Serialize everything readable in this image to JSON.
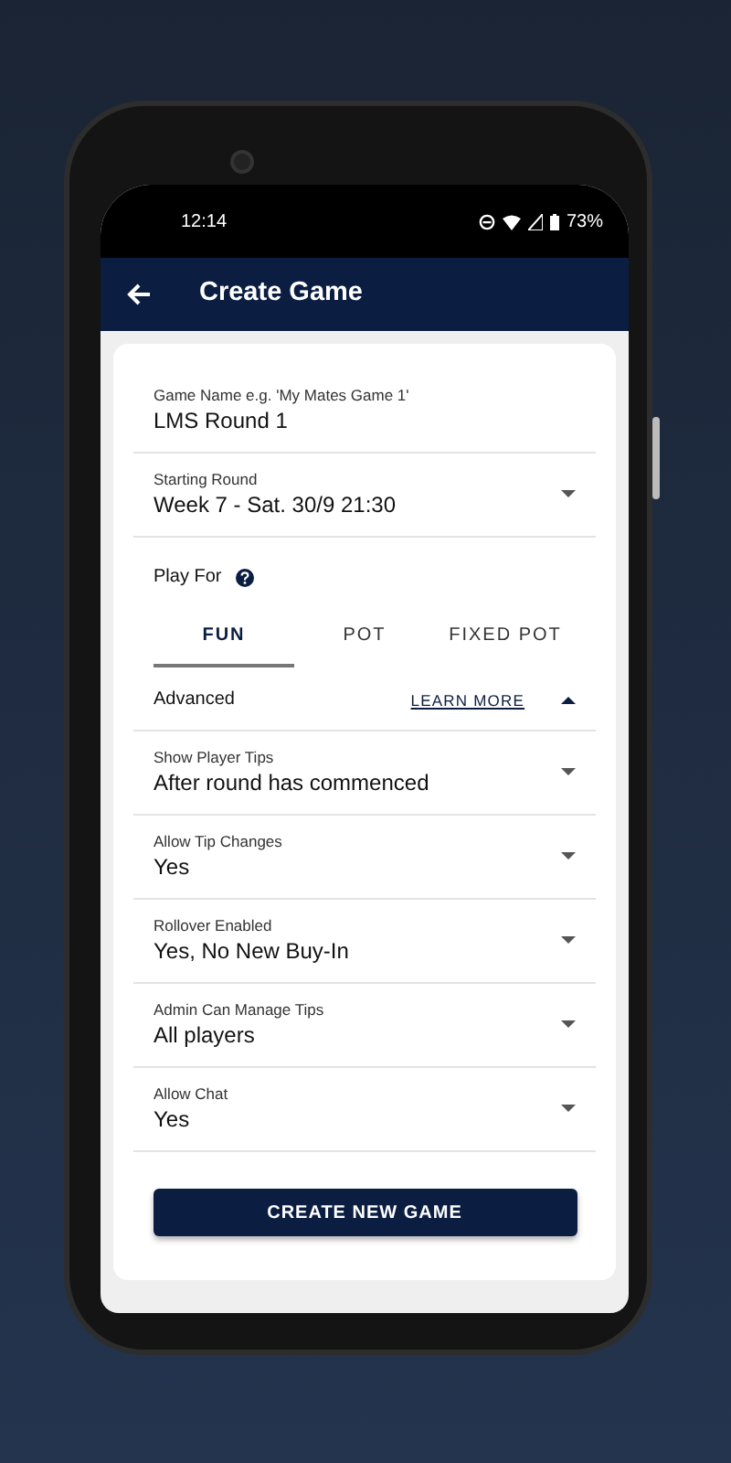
{
  "status_bar": {
    "time": "12:14",
    "battery": "73%"
  },
  "app_bar": {
    "title": "Create Game"
  },
  "fields": [
    {
      "kind": "text",
      "label": "Game Name e.g. 'My Mates Game 1'",
      "value": "LMS Round 1"
    },
    {
      "kind": "select",
      "label": "Starting Round",
      "value": "Week 7 - Sat. 30/9 21:30"
    }
  ],
  "play_for": {
    "label": "Play For",
    "tabs": [
      {
        "label": "FUN",
        "selected": true
      },
      {
        "label": "POT",
        "selected": false
      },
      {
        "label": "FIXED POT",
        "selected": false
      }
    ]
  },
  "advanced": {
    "label": "Advanced",
    "link": "LEARN MORE",
    "expanded": true
  },
  "advanced_fields": [
    {
      "kind": "select",
      "label": "Show Player Tips",
      "value": "After round has commenced"
    },
    {
      "kind": "select",
      "label": "Allow Tip Changes",
      "value": "Yes"
    },
    {
      "kind": "select",
      "label": "Rollover Enabled",
      "value": "Yes, No New Buy-In"
    },
    {
      "kind": "select",
      "label": "Admin Can Manage Tips",
      "value": "All players"
    },
    {
      "kind": "select",
      "label": "Allow Chat",
      "value": "Yes"
    }
  ],
  "button": "CREATE NEW GAME"
}
